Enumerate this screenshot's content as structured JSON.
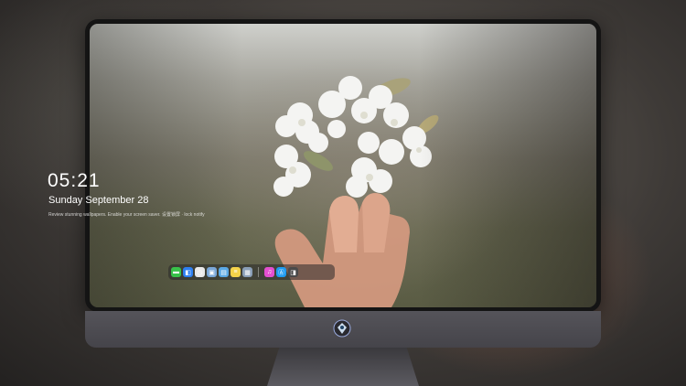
{
  "lockscreen": {
    "time": "05:21",
    "date": "Sunday September  28",
    "hint": "Review stunning wallpapers. Enable your screen saver. 设置锁屏 · lock notify"
  },
  "dock": {
    "apps": [
      {
        "name": "Messages",
        "icon": "messages-icon",
        "color": "#38c24a",
        "glyph": "▬"
      },
      {
        "name": "Finder",
        "icon": "finder-icon",
        "color": "#2d7ff0",
        "glyph": "◧"
      },
      {
        "name": "Clock",
        "icon": "clock-icon",
        "color": "#e9e9e9",
        "glyph": "◷"
      },
      {
        "name": "Preview",
        "icon": "preview-icon",
        "color": "#7aa7d8",
        "glyph": "▣"
      },
      {
        "name": "Clapper",
        "icon": "clapper-icon",
        "color": "#5aa9e6",
        "glyph": "▤"
      },
      {
        "name": "Notes",
        "icon": "notes-icon",
        "color": "#f3d24a",
        "glyph": "≡"
      },
      {
        "name": "Photos",
        "icon": "photos-icon",
        "color": "#8a9fb8",
        "glyph": "▦"
      },
      {
        "name": "Music",
        "icon": "music-icon",
        "color": "#e44fd0",
        "glyph": "♫"
      },
      {
        "name": "App Store",
        "icon": "appstore-icon",
        "color": "#1e9bf0",
        "glyph": "Ⓐ"
      },
      {
        "name": "Bag",
        "icon": "bag-icon",
        "color": "#4a4a4a",
        "glyph": "◨"
      }
    ]
  },
  "colors": {
    "accent": "#ffffff",
    "bezel": "#141414",
    "chin": "#4e4d53"
  }
}
